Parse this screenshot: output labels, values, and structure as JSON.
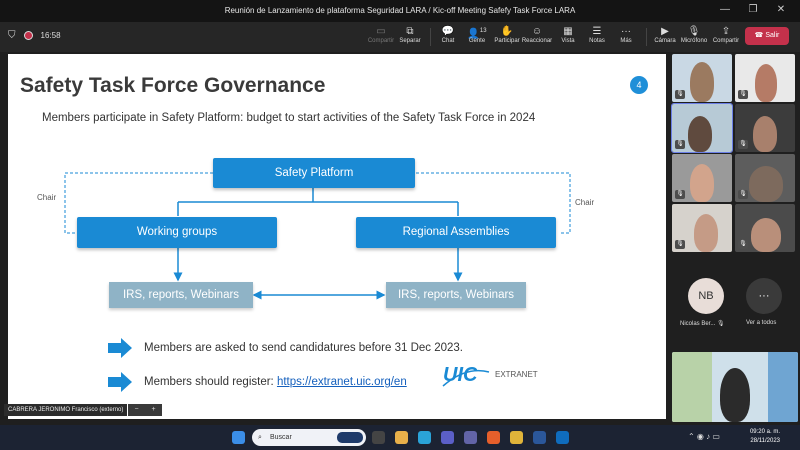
{
  "window": {
    "title": "Reunión de Lanzamiento de plataforma Seguridad LARA / Kic-off Meeting Safefy Task Force LARA"
  },
  "toolbar": {
    "timer": "16:58",
    "buttons": [
      {
        "label": "Compartir",
        "icon": "share-screen-icon",
        "disabled": true
      },
      {
        "label": "Separar",
        "icon": "pop-out-icon"
      },
      {
        "label": "Chat",
        "icon": "chat-icon"
      },
      {
        "label": "Gente",
        "icon": "people-icon",
        "badge": "13"
      },
      {
        "label": "Participar",
        "icon": "raise-hand-icon"
      },
      {
        "label": "Reaccionar",
        "icon": "smiley-icon"
      },
      {
        "label": "Vista",
        "icon": "grid-view-icon"
      },
      {
        "label": "Notas",
        "icon": "notes-icon"
      },
      {
        "label": "Más",
        "icon": "more-icon"
      },
      {
        "label": "Cámara",
        "icon": "camera-icon"
      },
      {
        "label": "Micrófono",
        "icon": "mic-off-icon"
      },
      {
        "label": "Compartir",
        "icon": "share-icon"
      }
    ],
    "leave": "Salir"
  },
  "slide": {
    "title": "Safety Task Force Governance",
    "page": "4",
    "subtitle": "Members participate in Safety Platform: budget to start activities of the Safety Task Force in 2024",
    "safety_platform": "Safety Platform",
    "working_groups": "Working groups",
    "regional_assemblies": "Regional Assemblies",
    "output_left": "IRS, reports, Webinars",
    "output_right": "IRS, reports, Webinars",
    "chair_left": "Chair",
    "chair_right": "Chair",
    "bullet1": "Members are asked to send candidatures before 31 Dec 2023.",
    "bullet2_prefix": "Members should register: ",
    "bullet2_link": "https://extranet.uic.org/en",
    "logo_text": "UIC",
    "logo_suffix": "EXTRANET"
  },
  "presenter_name": "CABRERA JERONIMO Francisco (externo)",
  "participants": {
    "avatar_initials": "NB",
    "avatar_name": "Nicolas Ber...",
    "see_all": "Ver a todos"
  },
  "taskbar": {
    "search_placeholder": "Buscar",
    "time": "09:20 a. m.",
    "date": "28/11/2023"
  },
  "colors": {
    "accent": "#1a8ad4",
    "leave": "#c4314b",
    "output_box": "#8fb3c6"
  }
}
